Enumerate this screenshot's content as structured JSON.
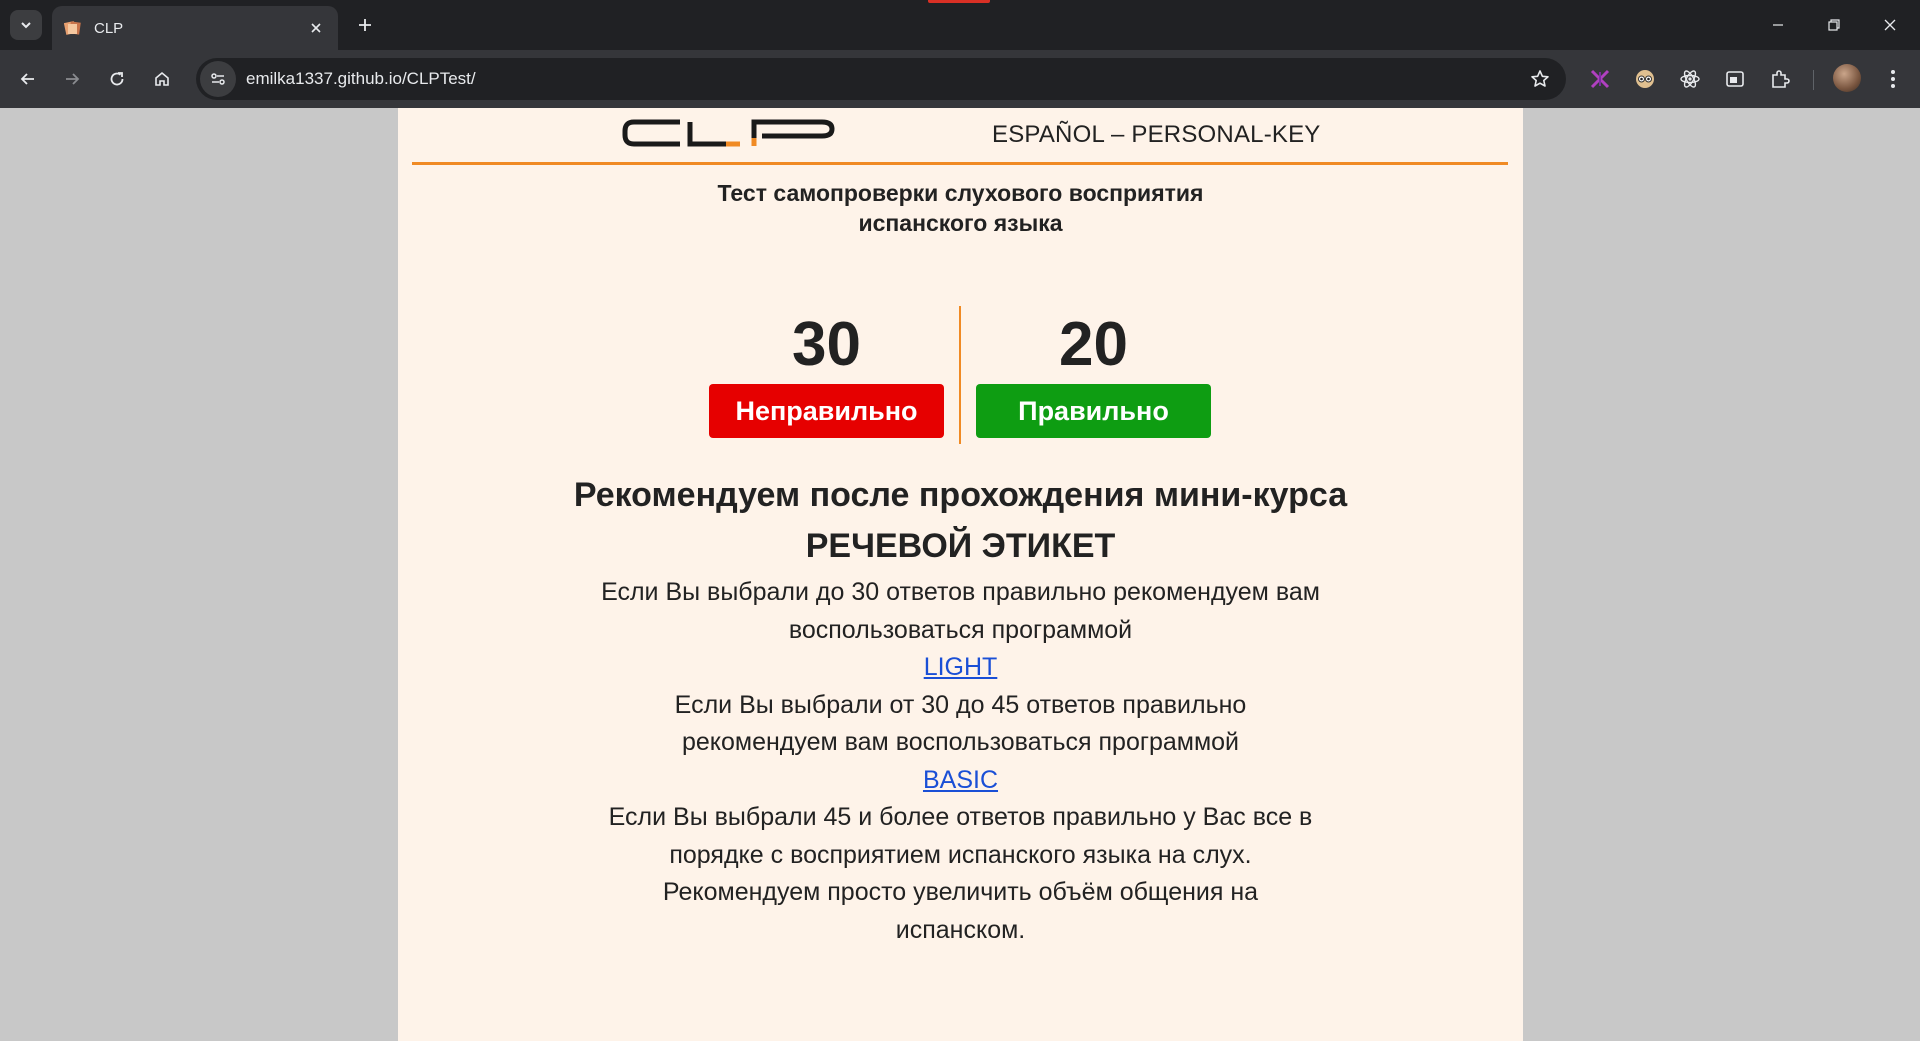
{
  "browser": {
    "tab_title": "CLP",
    "url": "emilka1337.github.io/CLPTest/",
    "extensions": [
      "ai-extension-icon",
      "eyes-extension-icon",
      "react-devtools-icon",
      "tab-manager-icon",
      "extensions-puzzle-icon"
    ]
  },
  "page": {
    "logo_text": "CLP",
    "lang_title": "ESPAÑOL – PERSONAL-KEY",
    "subtitle_line1": "Тест самопроверки слухового восприятия",
    "subtitle_line2": "испанского языка",
    "scores": {
      "wrong_count": "30",
      "wrong_label": "Неправильно",
      "right_count": "20",
      "right_label": "Правильно"
    },
    "recommendation": {
      "heading_line1": "Рекомендуем после прохождения мини-курса",
      "heading_line2": "РЕЧЕВОЙ ЭТИКЕТ",
      "para1": "Если Вы выбрали до 30 ответов правильно рекомендуем вам воспользоваться программой",
      "link1": "LIGHT",
      "para2": "Если Вы выбрали от 30 до 45 ответов правильно рекомендуем вам воспользоваться программой",
      "link2": "BASIC",
      "para3": "Если Вы выбрали 45 и более ответов правильно у Вас все в порядке с восприятием испанского языка на слух. Рекомендуем просто увеличить объём общения на испанском."
    }
  },
  "colors": {
    "accent_orange": "#f08a24",
    "wrong_red": "#e60000",
    "right_green": "#0e9d12",
    "page_bg": "#fef3e9",
    "link_blue": "#1a4fd6"
  }
}
